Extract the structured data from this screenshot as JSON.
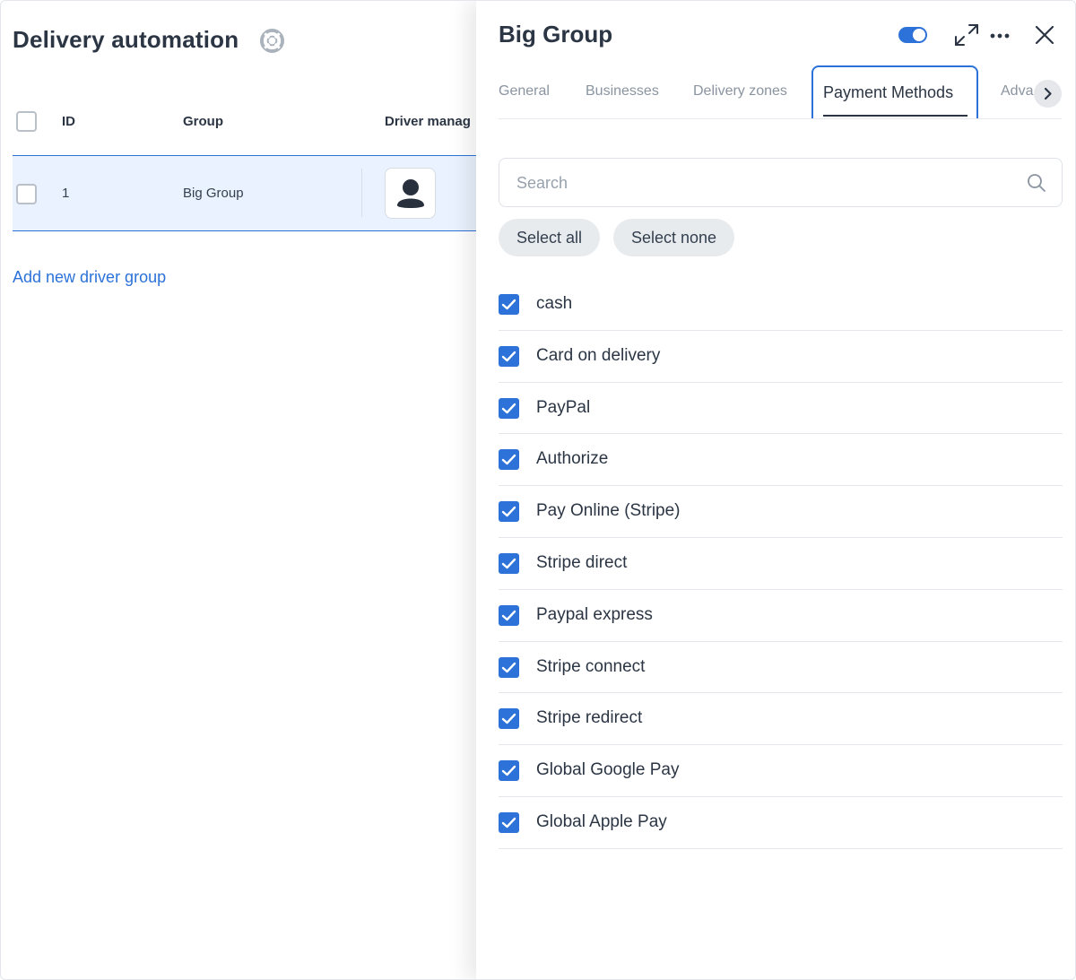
{
  "page": {
    "title": "Delivery automation",
    "help_icon": "lifebuoy-icon",
    "table": {
      "columns": [
        "ID",
        "Group",
        "Driver manag"
      ],
      "rows": [
        {
          "id": "1",
          "group": "Big Group",
          "avatar_icon": "user-icon"
        }
      ]
    },
    "add_link": "Add new driver group"
  },
  "panel": {
    "title": "Big Group",
    "enabled": true,
    "icons": [
      "toggle-switch",
      "expand-icon",
      "more-icon",
      "close-icon"
    ],
    "tabs": [
      {
        "label": "General",
        "active": false
      },
      {
        "label": "Businesses",
        "active": false
      },
      {
        "label": "Delivery zones",
        "active": false
      },
      {
        "label": "Payment Methods",
        "active": true
      },
      {
        "label": "Adva",
        "active": false
      }
    ],
    "search": {
      "placeholder": "Search",
      "value": ""
    },
    "select_all": "Select all",
    "select_none": "Select none",
    "methods": [
      {
        "label": "cash",
        "checked": true
      },
      {
        "label": "Card on delivery",
        "checked": true
      },
      {
        "label": "PayPal",
        "checked": true
      },
      {
        "label": "Authorize",
        "checked": true
      },
      {
        "label": "Pay Online (Stripe)",
        "checked": true
      },
      {
        "label": "Stripe direct",
        "checked": true
      },
      {
        "label": "Paypal express",
        "checked": true
      },
      {
        "label": "Stripe connect",
        "checked": true
      },
      {
        "label": "Stripe redirect",
        "checked": true
      },
      {
        "label": "Global Google Pay",
        "checked": true
      },
      {
        "label": "Global Apple Pay",
        "checked": true
      }
    ]
  },
  "colors": {
    "accent": "#2c72d8",
    "text": "#2b3544",
    "muted": "#8a94a0",
    "row_highlight": "#e9f2fe"
  }
}
